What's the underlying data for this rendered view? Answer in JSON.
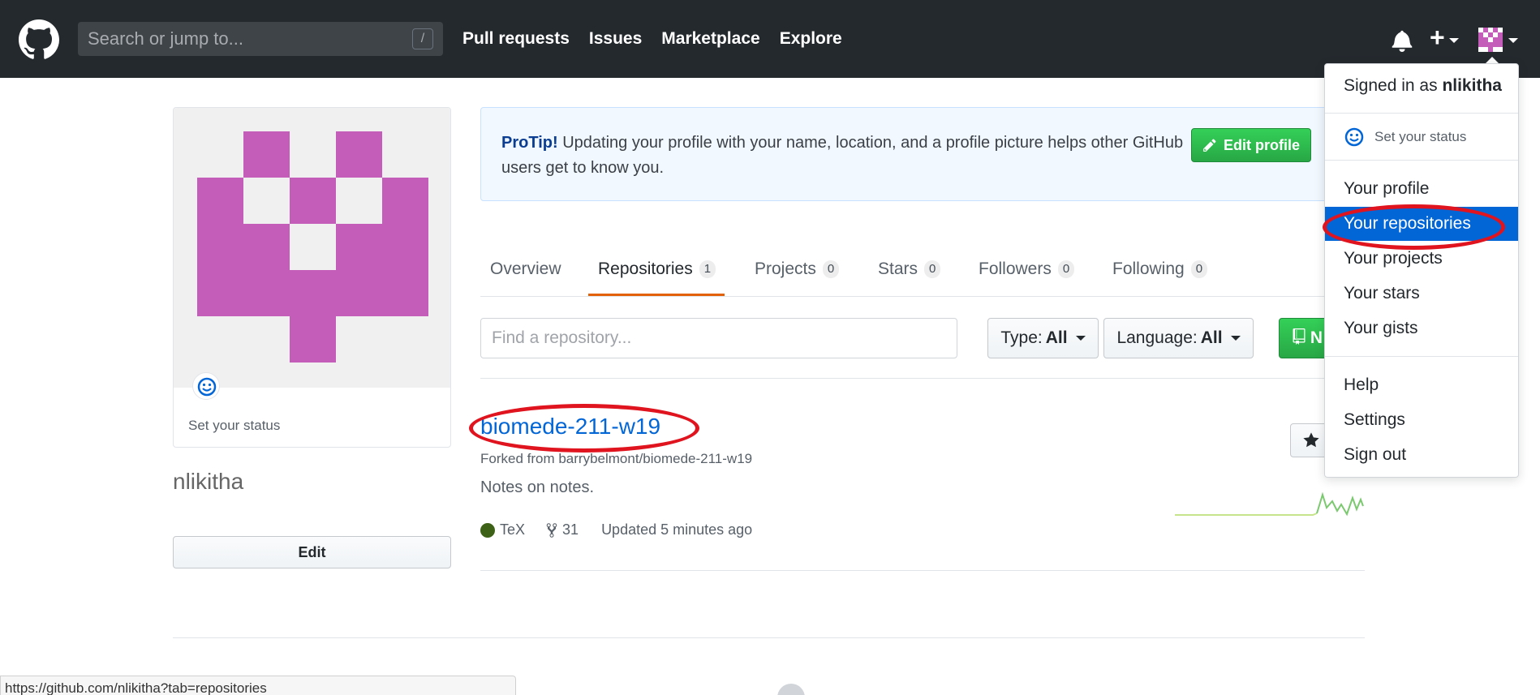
{
  "header": {
    "search_placeholder": "Search or jump to...",
    "search_key": "/",
    "nav": [
      "Pull requests",
      "Issues",
      "Marketplace",
      "Explore"
    ],
    "plus_label": "+"
  },
  "profile": {
    "set_status": "Set your status",
    "username": "nlikitha",
    "edit_label": "Edit",
    "avatar_color": "#c45cba"
  },
  "protip": {
    "title": "ProTip!",
    "text": " Updating your profile with your name, location, and a profile picture helps other GitHub users get to know you.",
    "button": "Edit profile"
  },
  "tabs": [
    {
      "label": "Overview",
      "count": ""
    },
    {
      "label": "Repositories",
      "count": "1"
    },
    {
      "label": "Projects",
      "count": "0"
    },
    {
      "label": "Stars",
      "count": "0"
    },
    {
      "label": "Followers",
      "count": "0"
    },
    {
      "label": "Following",
      "count": "0"
    }
  ],
  "filters": {
    "find_placeholder": "Find a repository...",
    "type_label": "Type:",
    "type_value": "All",
    "language_label": "Language:",
    "language_value": "All",
    "new_label": "N"
  },
  "repo": {
    "name": "biomede-211-w19",
    "forked_from": "Forked from barrybelmont/biomede-211-w19",
    "description": "Notes on notes.",
    "language": "TeX",
    "language_color": "#3d6117",
    "forks": "31",
    "updated": "Updated 5 minutes ago"
  },
  "dropdown": {
    "signed_in_prefix": "Signed in as",
    "signed_in_user": "nlikitha",
    "set_status": "Set your status",
    "items_top": [
      "Your profile",
      "Your repositories",
      "Your projects",
      "Your stars",
      "Your gists"
    ],
    "items_bottom": [
      "Help",
      "Settings",
      "Sign out"
    ]
  },
  "statusbar": {
    "url": "https://github.com/nlikitha?tab=repositories"
  },
  "colors": {
    "header_bg": "#24292e",
    "link": "#0366d6",
    "green": "#28a745",
    "highlight_oval": "#e0141e",
    "active_tab_underline": "#e36209"
  }
}
